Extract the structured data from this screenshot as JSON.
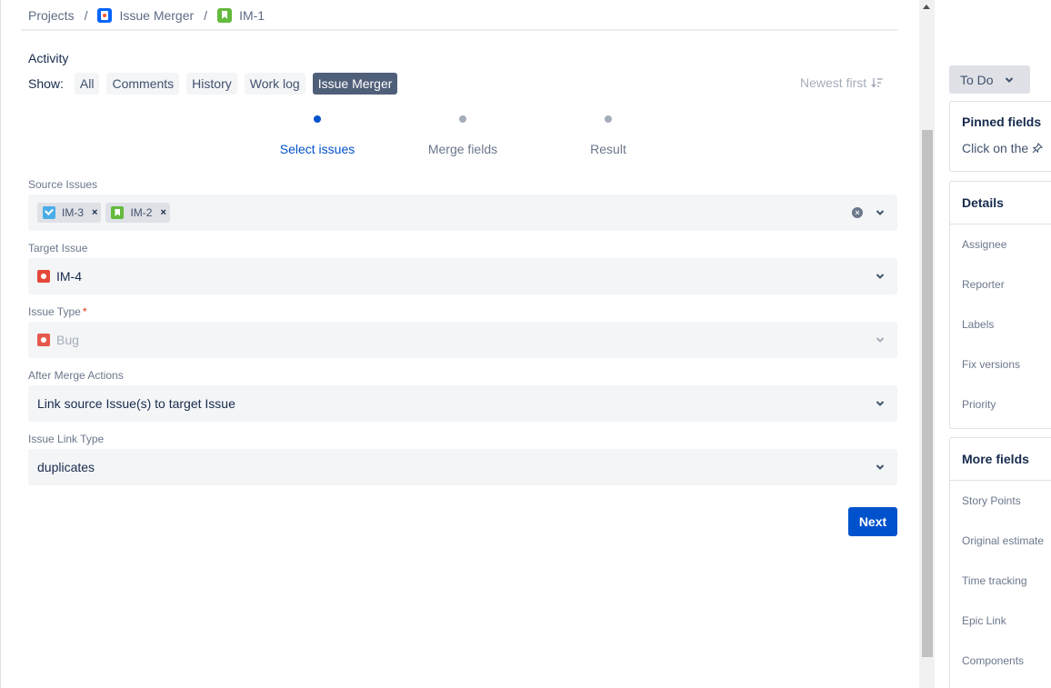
{
  "breadcrumb": {
    "projects": "Projects",
    "separator": "/",
    "project": "Issue Merger",
    "issue": "IM-1"
  },
  "activity": {
    "title": "Activity",
    "show_label": "Show:",
    "tabs": [
      {
        "label": "All",
        "active": false
      },
      {
        "label": "Comments",
        "active": false
      },
      {
        "label": "History",
        "active": false
      },
      {
        "label": "Work log",
        "active": false
      },
      {
        "label": "Issue Merger",
        "active": true
      }
    ],
    "sort_label": "Newest first"
  },
  "stepper": {
    "steps": [
      {
        "label": "Select issues",
        "active": true
      },
      {
        "label": "Merge fields",
        "active": false
      },
      {
        "label": "Result",
        "active": false
      }
    ]
  },
  "form": {
    "source_issues": {
      "label": "Source Issues",
      "chips": [
        {
          "key": "IM-3",
          "type": "task"
        },
        {
          "key": "IM-2",
          "type": "story"
        }
      ],
      "remove_glyph": "×",
      "clear_glyph": "×"
    },
    "target_issue": {
      "label": "Target Issue",
      "value": "IM-4",
      "type": "bug"
    },
    "issue_type": {
      "label": "Issue Type",
      "required_mark": "*",
      "value": "Bug",
      "type": "bug",
      "disabled": true
    },
    "after_merge": {
      "label": "After Merge Actions",
      "value": "Link source Issue(s) to target Issue"
    },
    "link_type": {
      "label": "Issue Link Type",
      "value": "duplicates"
    },
    "next_label": "Next"
  },
  "sidebar": {
    "status": "To Do",
    "pinned": {
      "title": "Pinned fields",
      "text": "Click on the"
    },
    "details": {
      "title": "Details",
      "fields": [
        "Assignee",
        "Reporter",
        "Labels",
        "Fix versions",
        "Priority"
      ]
    },
    "more_fields": {
      "title": "More fields",
      "fields": [
        "Story Points",
        "Original estimate",
        "Time tracking",
        "Epic Link",
        "Components"
      ]
    }
  },
  "colors": {
    "primary": "#0052cc",
    "active_tab": "#505f79",
    "bug": "#e5493a",
    "story": "#63ba3c",
    "task": "#4bade8"
  }
}
